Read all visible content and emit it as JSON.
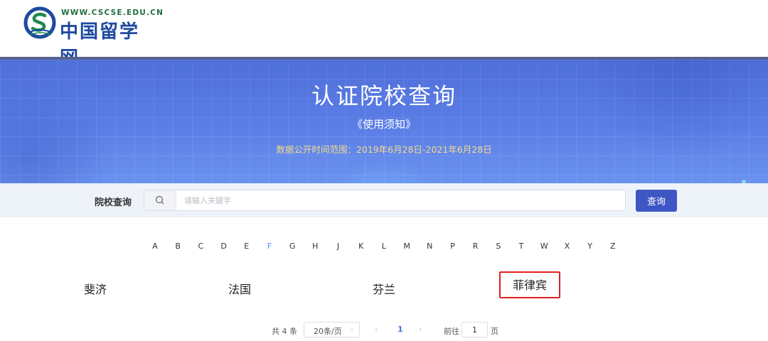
{
  "header": {
    "logo_url_text": "WWW.CSCSE.EDU.CN",
    "logo_name": "中国留学网"
  },
  "banner": {
    "title": "认证院校查询",
    "notice_link": "《使用须知》",
    "range_label": "数据公开时间范围：",
    "range_value": "2019年6月28日-2021年6月28日"
  },
  "search": {
    "label": "院校查询",
    "placeholder": "请输入关键字",
    "button_label": "查询"
  },
  "alphabet": {
    "letters": [
      "A",
      "B",
      "C",
      "D",
      "E",
      "F",
      "G",
      "H",
      "J",
      "K",
      "L",
      "M",
      "N",
      "P",
      "R",
      "S",
      "T",
      "W",
      "X",
      "Y",
      "Z"
    ],
    "active": "F"
  },
  "countries": [
    "斐济",
    "法国",
    "芬兰",
    "菲律宾"
  ],
  "pagination": {
    "total": "共 4 条",
    "page_size": "20条/页",
    "current_page": "1",
    "goto_label": "前往",
    "goto_value": "1",
    "page_unit": "页"
  },
  "colors": {
    "brand_blue": "#3e55c4",
    "banner_blue": "#5b7ee6",
    "highlight_red": "#e02020",
    "active_letter": "#4a8fe6"
  }
}
